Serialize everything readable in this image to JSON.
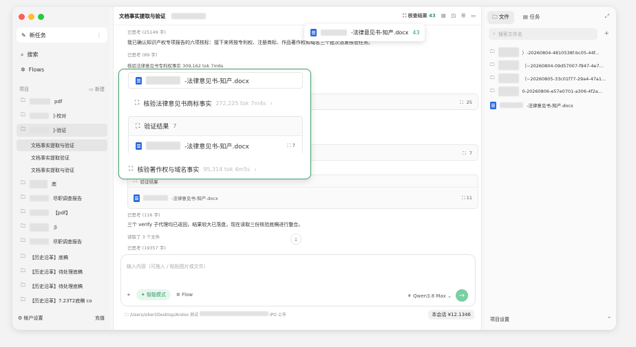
{
  "window_colors": {
    "close": "#fe5f57",
    "min": "#febc2e",
    "max": "#28c840"
  },
  "sidebar": {
    "new_task": "新任务",
    "search": "搜索",
    "flows": "Flows",
    "projects_label": "项目",
    "new_label": "新建",
    "projects": [
      {
        "label": "pdf"
      },
      {
        "label": "]-校对"
      },
      {
        "label": "]-验证"
      },
      {
        "label": "底"
      },
      {
        "label": "尽职调查报告"
      },
      {
        "label": "【pdf】"
      },
      {
        "label": "彡"
      },
      {
        "label": "尽职调查报告"
      },
      {
        "label": "【历史沿革】底稿"
      },
      {
        "label": "【历史沿革】待处理底稿"
      },
      {
        "label": "【历史沿革】待处理底稿"
      },
      {
        "label": "【历史沿革】7.23T2底稿 co"
      }
    ],
    "subitems": [
      "文档事实提取与验证",
      "文档事实提取验证",
      "文档事实提取与验证"
    ],
    "account": "帐户设置",
    "recharge": "充值"
  },
  "main": {
    "title": "文档事实提取与验证",
    "verify_label": "核查结果",
    "verify_count": "43",
    "lines": {
      "thought1": "已思考 (25149 字)",
      "para1": "我已确认知识产权专项报告的六项核标：接下来将按专利权、注册商标、作品著作权和域名三个批次派发核验任务。",
      "thought2": "已思考 (89 字)",
      "task1": "核验法律意见书专利权事实 309,162 tok 7m6s",
      "thought3": "已思考 (116 字)",
      "para2": "三个 verify 子代理均已返回，结果较大已落盘，现在读取三份核验底稿进行整合。",
      "read_files": "读取了 3 个文件",
      "thought4": "已思考 (19357 字)"
    },
    "card_count_25": "25",
    "card_count_7": "7",
    "card_count_11": "11",
    "card_verify": "验证结果",
    "card_file": "-法律意见书-知产.docx",
    "input_placeholder": "输入内容（可拖入 / 粘贴图片或文件）",
    "smart_mode": "智能模式",
    "flow": "Flow",
    "model": "Qwen3.8 Max",
    "path": "/Users/siberl/Desktop/Andoo 测试",
    "path_tail": "IPO 上市",
    "cost": "本会话 ¥12.1346"
  },
  "popup": {
    "file": "-法律意见书-知产.docx",
    "task2": "核验法律意见书商标事实",
    "task2_meta": "272,225 tok 7m4s",
    "verify": "验证结果",
    "verify_count": "7",
    "task3": "核验著作权与域名事实",
    "task3_meta": "95,314 tok 4m5s"
  },
  "tooltip": {
    "file": "-法律意见书-知产.docx",
    "count": "43"
  },
  "right": {
    "tab_files": "文件",
    "tab_tasks": "任务",
    "search_placeholder": "搜索文件名",
    "files": [
      "）-20260804-4810538f-bc05-44f...",
      "（~20260804-09d57007-f947-4e7...",
      "（~20260805-33c01f77-29a4-47a1...",
      "0-20260806-e57e0701-a306-4f2a...",
      "-法律意见书-知产.docx"
    ],
    "footer": "项目设置"
  }
}
